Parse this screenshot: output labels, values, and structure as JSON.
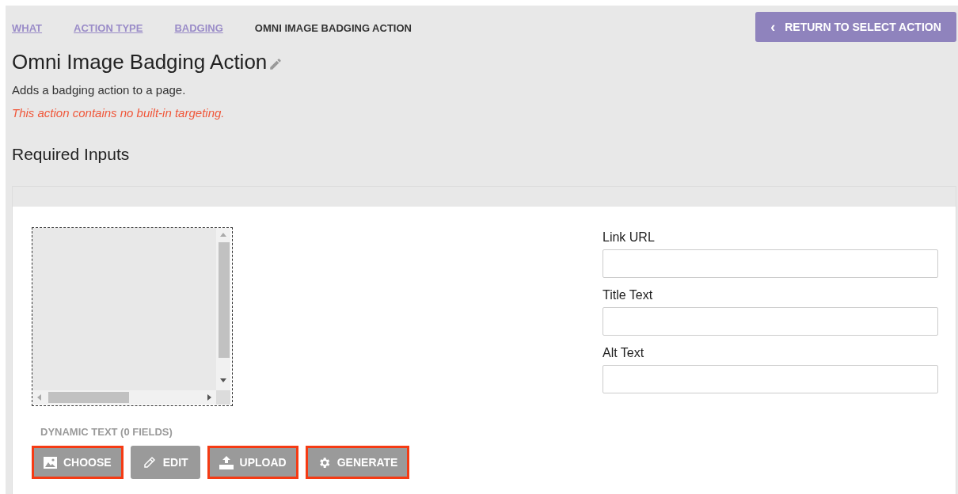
{
  "breadcrumbs": [
    {
      "label": "WHAT",
      "current": false
    },
    {
      "label": "ACTION TYPE",
      "current": false
    },
    {
      "label": "BADGING",
      "current": false
    },
    {
      "label": "OMNI IMAGE BADGING ACTION",
      "current": true
    }
  ],
  "return_button": {
    "label": "RETURN TO SELECT ACTION",
    "icon": "‹"
  },
  "title": "Omni Image Badging Action",
  "description": "Adds a badging action to a page.",
  "warning": "This action contains no built-in targeting.",
  "section_title": "Required Inputs",
  "dynamic_text_label": "DYNAMIC TEXT (0 FIELDS)",
  "buttons": [
    {
      "label": "CHOOSE",
      "kind": "image",
      "highlighted": true
    },
    {
      "label": "EDIT",
      "kind": "pencil",
      "highlighted": false
    },
    {
      "label": "UPLOAD",
      "kind": "upload",
      "highlighted": true
    },
    {
      "label": "GENERATE",
      "kind": "gear",
      "highlighted": true
    }
  ],
  "fields": [
    {
      "label": "Link URL"
    },
    {
      "label": "Title Text"
    },
    {
      "label": "Alt Text"
    }
  ]
}
